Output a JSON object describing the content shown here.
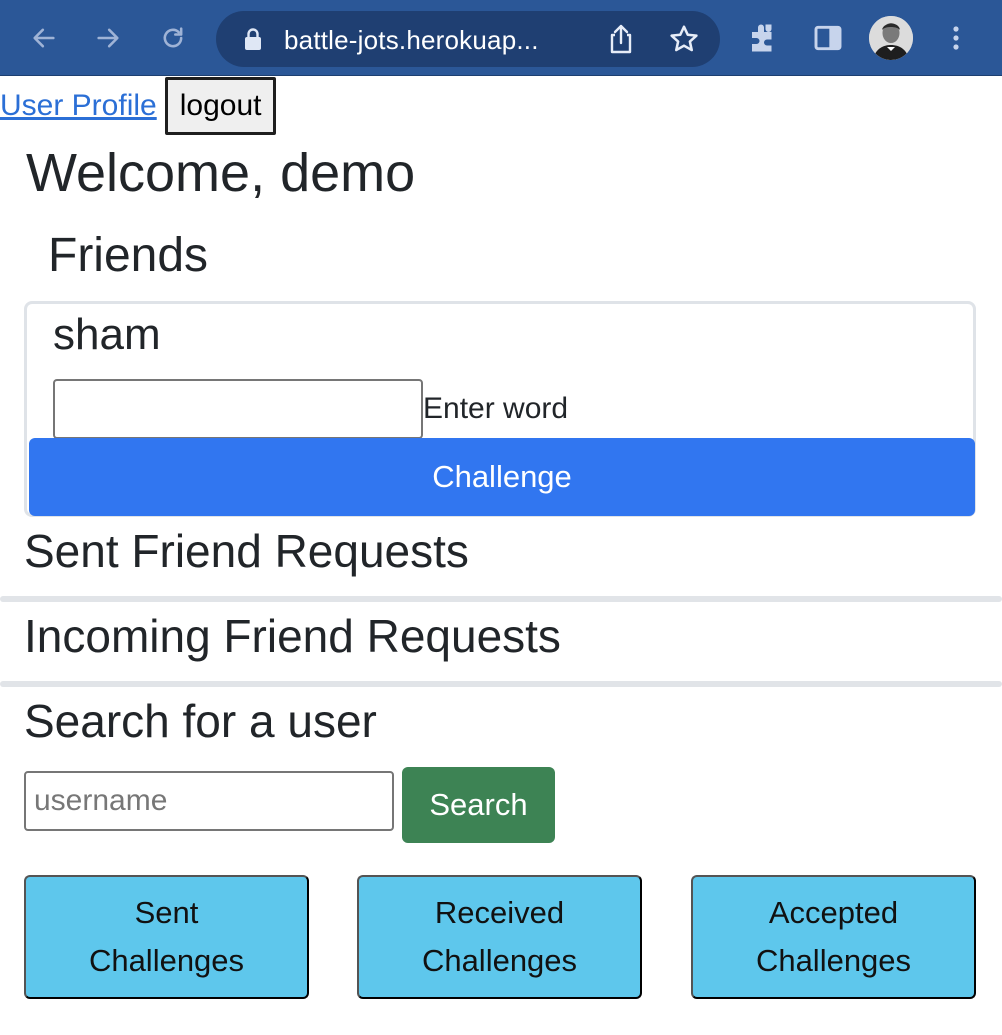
{
  "browser": {
    "url": "battle-jots.herokuap...",
    "icons": [
      "back-arrow-icon",
      "forward-arrow-icon",
      "reload-icon",
      "lock-icon",
      "share-icon",
      "star-icon",
      "extensions-icon",
      "side-panel-icon",
      "profile-avatar",
      "more-menu-icon"
    ],
    "toolbar_color": "#2b5797"
  },
  "header": {
    "profile_link": "User Profile",
    "logout_label": "logout"
  },
  "welcome_title": "Welcome, demo",
  "friends": {
    "heading": "Friends",
    "items": [
      {
        "name": "sham",
        "input_value": "",
        "input_label": "Enter word",
        "challenge_label": "Challenge"
      }
    ]
  },
  "sent_requests": {
    "heading": "Sent Friend Requests"
  },
  "incoming_requests": {
    "heading": "Incoming Friend Requests"
  },
  "user_search": {
    "heading": "Search for a user",
    "placeholder": "username",
    "button_label": "Search"
  },
  "challenge_tabs": [
    {
      "line1": "Sent",
      "line2": "Challenges"
    },
    {
      "line1": "Received",
      "line2": "Challenges"
    },
    {
      "line1": "Accepted",
      "line2": "Challenges"
    }
  ],
  "colors": {
    "primary": "#3176f0",
    "success": "#3d8354",
    "info": "#5ec7ec",
    "link": "#2b6fd6"
  }
}
